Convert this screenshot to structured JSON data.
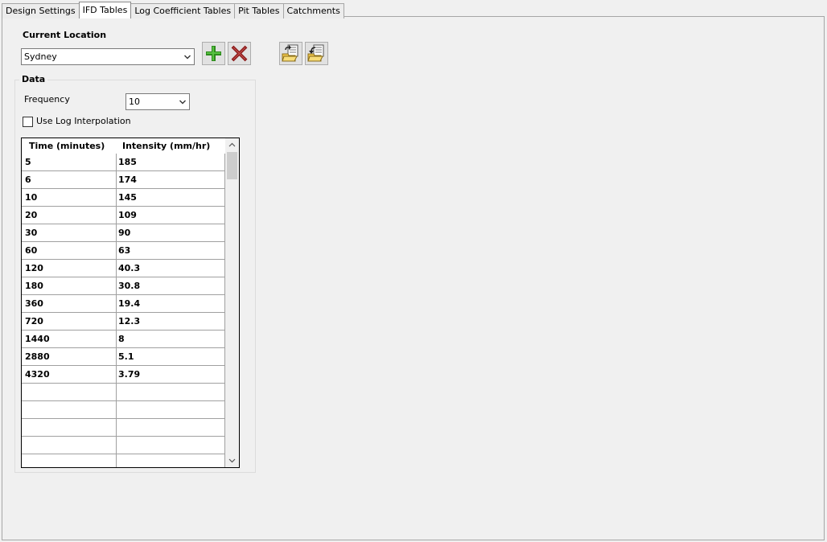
{
  "tabs": [
    {
      "label": "Design Settings",
      "active": false
    },
    {
      "label": "IFD Tables",
      "active": true
    },
    {
      "label": "Log Coefficient Tables",
      "active": false
    },
    {
      "label": "Pit Tables",
      "active": false
    },
    {
      "label": "Catchments",
      "active": false
    }
  ],
  "location": {
    "label": "Current Location",
    "selected": "Sydney"
  },
  "data_group": {
    "title": "Data",
    "frequency_label": "Frequency",
    "frequency_value": "10",
    "log_interp_label": "Use Log Interpolation",
    "log_interp_checked": false
  },
  "table": {
    "columns": [
      "Time (minutes)",
      "Intensity (mm/hr)"
    ],
    "rows": [
      [
        "5",
        "185"
      ],
      [
        "6",
        "174"
      ],
      [
        "10",
        "145"
      ],
      [
        "20",
        "109"
      ],
      [
        "30",
        "90"
      ],
      [
        "60",
        "63"
      ],
      [
        "120",
        "40.3"
      ],
      [
        "180",
        "30.8"
      ],
      [
        "360",
        "19.4"
      ],
      [
        "720",
        "12.3"
      ],
      [
        "1440",
        "8"
      ],
      [
        "2880",
        "5.1"
      ],
      [
        "4320",
        "3.79"
      ],
      [
        "",
        ""
      ],
      [
        "",
        ""
      ],
      [
        "",
        ""
      ],
      [
        "",
        ""
      ],
      [
        "",
        ""
      ]
    ]
  },
  "icons": {
    "add": "plus-icon",
    "delete": "delete-x-icon",
    "import": "open-folder-import-icon",
    "export": "open-folder-export-icon"
  },
  "colors": {
    "add_green": "#2e8b1e",
    "delete_red": "#8b1a1a",
    "folder_yellow": "#f2c84b"
  }
}
